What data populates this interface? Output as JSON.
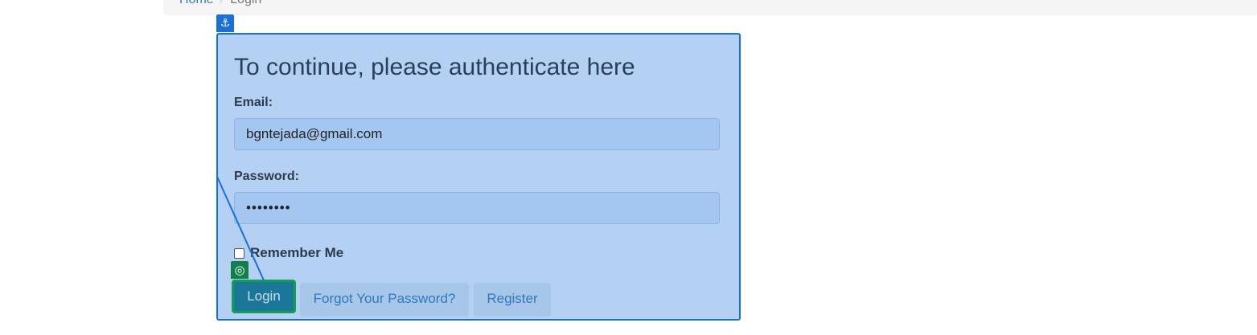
{
  "breadcrumb": {
    "home": "Home",
    "separator": "/",
    "current": "Login"
  },
  "overlay": {
    "anchor_icon": "⚓",
    "target_icon": "◎"
  },
  "form": {
    "title": "To continue, please authenticate here",
    "email_label": "Email:",
    "email_value": "bgntejada@gmail.com",
    "password_label": "Password:",
    "password_value": "••••••••",
    "remember_label": "Remember Me",
    "remember_checked": false,
    "login_label": "Login",
    "forgot_label": "Forgot Your Password?",
    "register_label": "Register"
  },
  "colors": {
    "panel_bg": "#b4d1f4",
    "panel_border": "#1a6fd8",
    "highlight": "#10a050"
  }
}
